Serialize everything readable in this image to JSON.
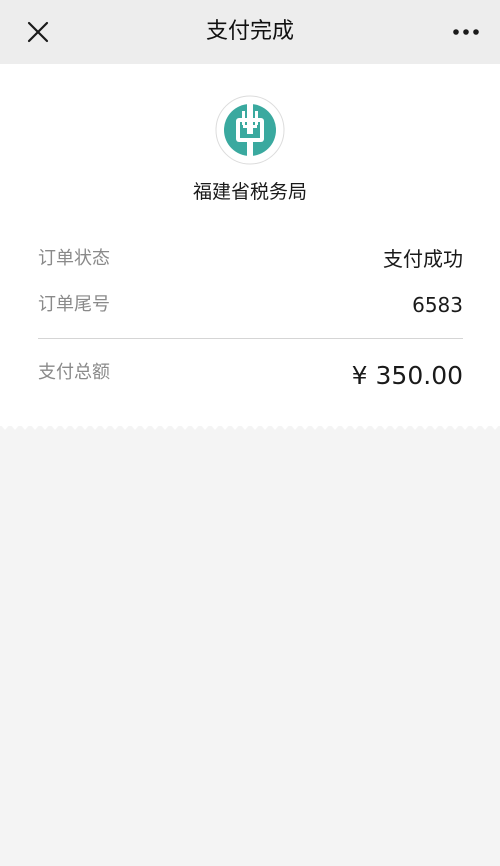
{
  "header": {
    "title": "支付完成",
    "close_icon": "close-icon",
    "more_icon": "more-icon"
  },
  "merchant": {
    "name": "福建省税务局",
    "logo_icon": "bank-logo-icon",
    "logo_color": "#3aa99f"
  },
  "order": {
    "status_label": "订单状态",
    "status_value": "支付成功",
    "tail_label": "订单尾号",
    "tail_value": "6583",
    "total_label": "支付总额",
    "total_value": "¥ 350.00"
  },
  "colors": {
    "header_bg": "#ededed",
    "page_bg": "#f4f4f4",
    "card_bg": "#ffffff",
    "accent": "#3aa99f"
  }
}
